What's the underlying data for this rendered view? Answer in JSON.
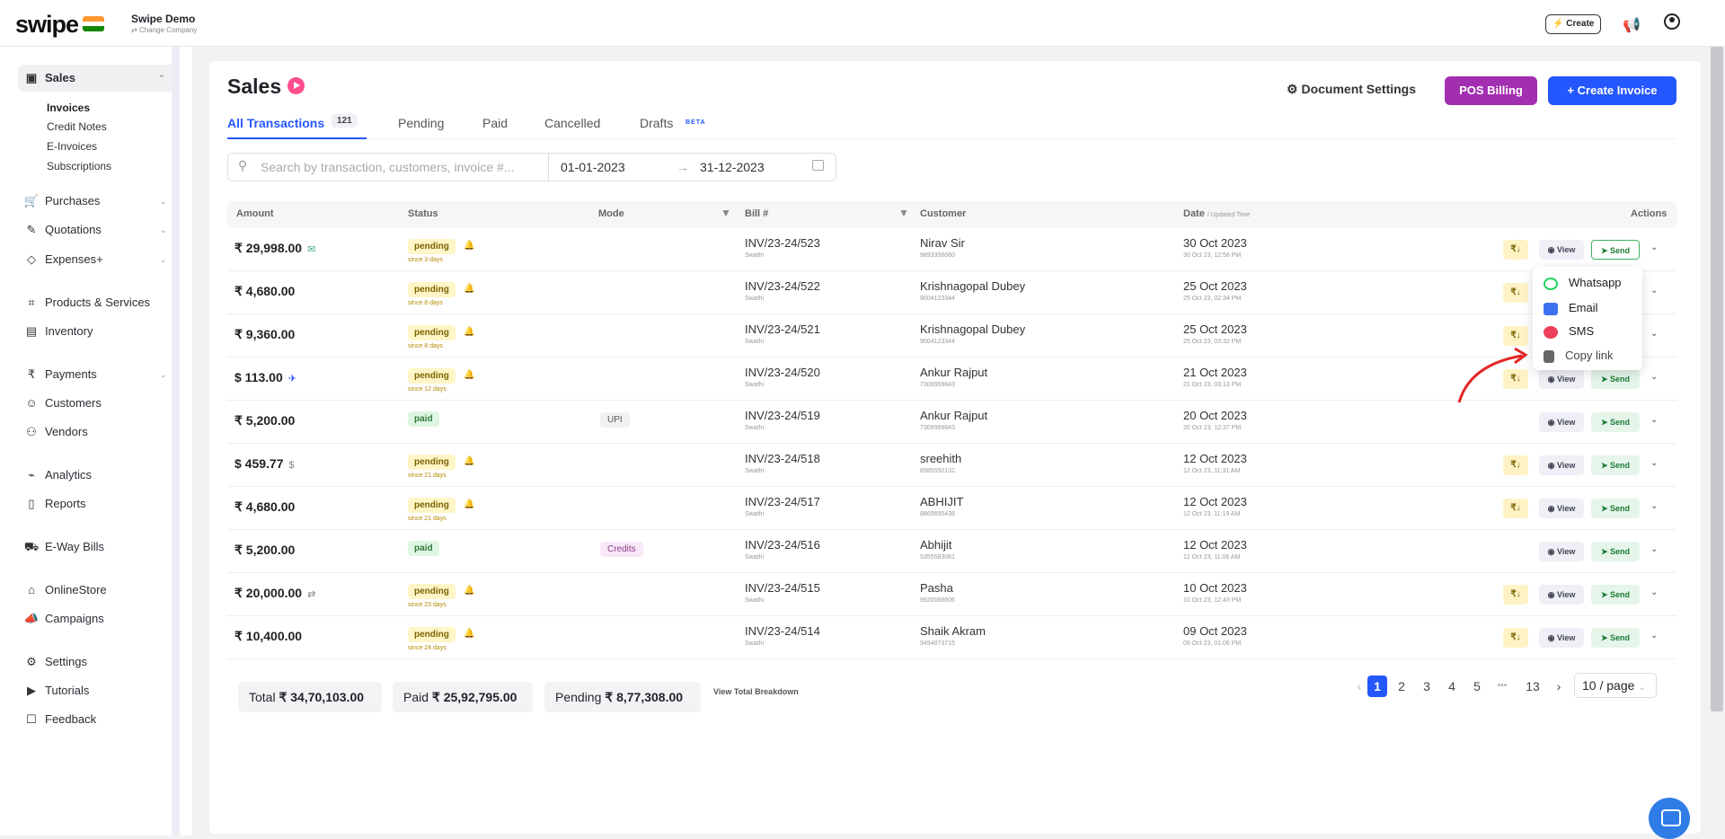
{
  "topbar": {
    "logo": "swipe",
    "company": "Swipe Demo",
    "company_sub": "⇄ Change Company",
    "create": "Create"
  },
  "sidebar": {
    "sales": "Sales",
    "sales_sub": [
      "Invoices",
      "Credit Notes",
      "E-Invoices",
      "Subscriptions"
    ],
    "items": [
      "Purchases",
      "Quotations",
      "Expenses+",
      "Products & Services",
      "Inventory",
      "Payments",
      "Customers",
      "Vendors",
      "Analytics",
      "Reports",
      "E-Way Bills",
      "OnlineStore",
      "Campaigns",
      "Settings",
      "Tutorials",
      "Feedback"
    ]
  },
  "page": {
    "title": "Sales",
    "doc_settings": "Document Settings",
    "pos_billing": "POS Billing",
    "create_invoice": "+ Create Invoice"
  },
  "tabs": {
    "all": "All Transactions",
    "all_count": "121",
    "pending": "Pending",
    "paid": "Paid",
    "cancelled": "Cancelled",
    "drafts": "Drafts",
    "beta": "BETA"
  },
  "filters": {
    "search_placeholder": "Search by transaction, customers, invoice #...",
    "date_from": "01-01-2023",
    "date_to": "31-12-2023"
  },
  "table": {
    "headers": {
      "amount": "Amount",
      "status": "Status",
      "mode": "Mode",
      "bill": "Bill #",
      "customer": "Customer",
      "date": "Date",
      "date_sub": "/ Updated Time",
      "actions": "Actions"
    },
    "rows": [
      {
        "amount": "₹ 29,998.00",
        "status": "pending",
        "since": "since 3 days",
        "mode": "",
        "bill": "INV/23-24/523",
        "bill_sub": "Swathi",
        "customer": "Nirav Sir",
        "customer_sub": "9893356660",
        "date": "30 Oct 2023",
        "date_sub": "30 Oct 23, 12:58 PM"
      },
      {
        "amount": "₹ 4,680.00",
        "status": "pending",
        "since": "since 8 days",
        "mode": "",
        "bill": "INV/23-24/522",
        "bill_sub": "Swathi",
        "customer": "Krishnagopal Dubey",
        "customer_sub": "9004123344",
        "date": "25 Oct 2023",
        "date_sub": "25 Oct 23, 02:34 PM"
      },
      {
        "amount": "₹ 9,360.00",
        "status": "pending",
        "since": "since 8 days",
        "mode": "",
        "bill": "INV/23-24/521",
        "bill_sub": "Swathi",
        "customer": "Krishnagopal Dubey",
        "customer_sub": "9004123344",
        "date": "25 Oct 2023",
        "date_sub": "25 Oct 23, 03:32 PM"
      },
      {
        "amount": "$ 113.00",
        "status": "pending",
        "since": "since 12 days",
        "mode": "",
        "bill": "INV/23-24/520",
        "bill_sub": "Swathi",
        "customer": "Ankur Rajput",
        "customer_sub": "7309969843",
        "date": "21 Oct 2023",
        "date_sub": "21 Oct 23, 03:13 PM"
      },
      {
        "amount": "₹ 5,200.00",
        "status": "paid",
        "since": "",
        "mode": "UPI",
        "bill": "INV/23-24/519",
        "bill_sub": "Swathi",
        "customer": "Ankur Rajput",
        "customer_sub": "7309969843",
        "date": "20 Oct 2023",
        "date_sub": "20 Oct 23, 12:37 PM"
      },
      {
        "amount": "$ 459.77",
        "status": "pending",
        "since": "since 21 days",
        "mode": "",
        "bill": "INV/23-24/518",
        "bill_sub": "Swathi",
        "customer": "sreehith",
        "customer_sub": "8985550131",
        "date": "12 Oct 2023",
        "date_sub": "12 Oct 23, 11:31 AM"
      },
      {
        "amount": "₹ 4,680.00",
        "status": "pending",
        "since": "since 21 days",
        "mode": "",
        "bill": "INV/23-24/517",
        "bill_sub": "Swathi",
        "customer": "ABHIJIT",
        "customer_sub": "8869695438",
        "date": "12 Oct 2023",
        "date_sub": "12 Oct 23, 11:19 AM"
      },
      {
        "amount": "₹ 5,200.00",
        "status": "paid",
        "since": "",
        "mode": "Credits",
        "bill": "INV/23-24/516",
        "bill_sub": "Swathi",
        "customer": "Abhijit",
        "customer_sub": "5355583081",
        "date": "12 Oct 2023",
        "date_sub": "12 Oct 23, 11:06 AM"
      },
      {
        "amount": "₹ 20,000.00",
        "status": "pending",
        "since": "since 23 days",
        "mode": "",
        "bill": "INV/23-24/515",
        "bill_sub": "Swathi",
        "customer": "Pasha",
        "customer_sub": "9620088606",
        "date": "10 Oct 2023",
        "date_sub": "10 Oct 23, 12:43 PM"
      },
      {
        "amount": "₹ 10,400.00",
        "status": "pending",
        "since": "since 24 days",
        "mode": "",
        "bill": "INV/23-24/514",
        "bill_sub": "Swathi",
        "customer": "Shaik Akram",
        "customer_sub": "9494073715",
        "date": "09 Oct 2023",
        "date_sub": "09 Oct 23, 01:06 PM"
      }
    ],
    "actions": {
      "rupee": "₹↓",
      "view": "View",
      "send": "Send"
    }
  },
  "send_dropdown": {
    "items": [
      "Whatsapp",
      "Email",
      "SMS",
      "Copy link"
    ]
  },
  "totals": {
    "total_label": "Total",
    "total_value": "₹ 34,70,103.00",
    "paid_label": "Paid",
    "paid_value": "₹ 25,92,795.00",
    "pending_label": "Pending",
    "pending_value": "₹ 8,77,308.00",
    "breakdown": "View Total Breakdown"
  },
  "pagination": {
    "pages": [
      "1",
      "2",
      "3",
      "4",
      "5",
      "•••",
      "13"
    ],
    "page_size": "10 / page",
    "current": "1"
  },
  "colors": {
    "accent": "#2557ff",
    "pos": "#a12fb0",
    "pending": "#fff5c6",
    "paid": "#def6e2",
    "annotation_arrow": "#e32626"
  }
}
